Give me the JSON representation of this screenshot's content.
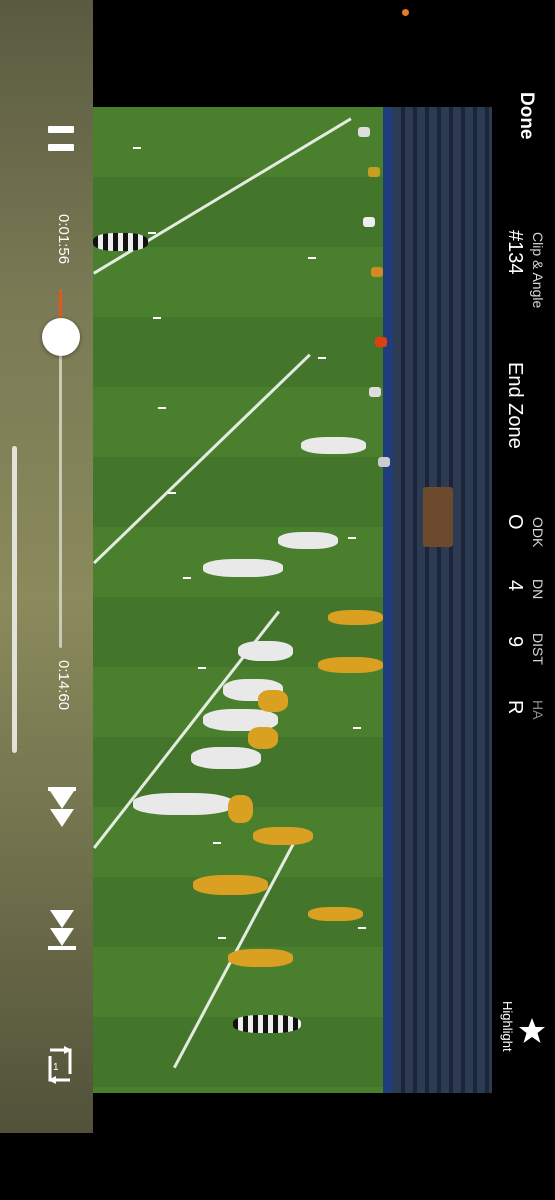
{
  "player": {
    "current_time": "0:01:56",
    "total_time": "0:14:60",
    "progress": 0.13,
    "controls": [
      "pause-icon",
      "skip-back-icon",
      "skip-forward-icon",
      "loop-icon"
    ]
  },
  "header": {
    "done_label": "Done",
    "clip_angle_label": "Clip & Angle",
    "clip_number": "#134",
    "angle_value": "End Zone"
  },
  "stats": [
    {
      "label": "ODK",
      "value": "O"
    },
    {
      "label": "DN",
      "value": "4"
    },
    {
      "label": "DIST",
      "value": "9"
    },
    {
      "label": "HA",
      "value": "R"
    }
  ],
  "highlight": {
    "label": "Highlight",
    "icon": "star-icon"
  },
  "colors": {
    "accent": "#e8541f",
    "status_dot": "#e07b2a"
  }
}
